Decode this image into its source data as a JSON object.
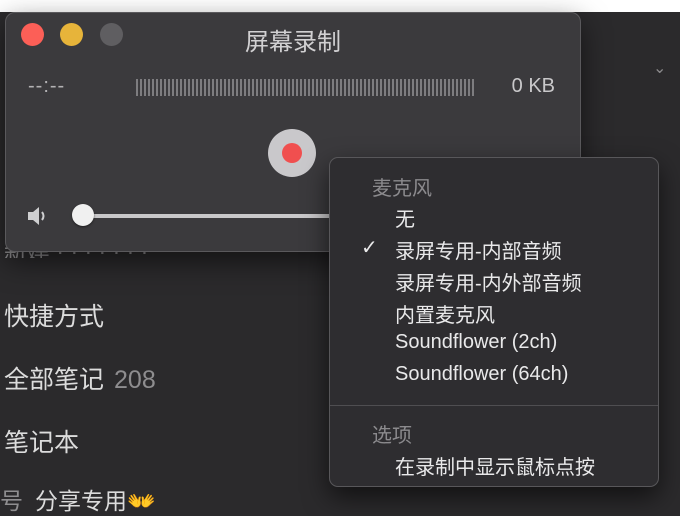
{
  "background": {
    "shortcuts": "快捷方式",
    "all_notes": "全部笔记",
    "all_notes_count": "208",
    "notebooks": "笔记本",
    "clipped_text": "新建 · · · ·  ·  ·  ·",
    "bottom_prefix": "号",
    "bottom_item": "分享专用👐"
  },
  "recorder": {
    "title": "屏幕录制",
    "timer": "--:--",
    "file_size": "0 KB"
  },
  "menu": {
    "mic_header": "麦克风",
    "mic_items": [
      "无",
      "录屏专用-内部音频",
      "录屏专用-内外部音频",
      "内置麦克风",
      "Soundflower (2ch)",
      "Soundflower (64ch)"
    ],
    "checked_index": 1,
    "check_mark": "✓",
    "options_header": "选项",
    "options_items": [
      "在录制中显示鼠标点按"
    ]
  },
  "colors": {
    "close": "#fc5f57",
    "minimize": "#e7b43a",
    "record": "#f04f4f"
  },
  "icons": {
    "chevron": "chevron-down-icon",
    "volume": "speaker-icon"
  }
}
